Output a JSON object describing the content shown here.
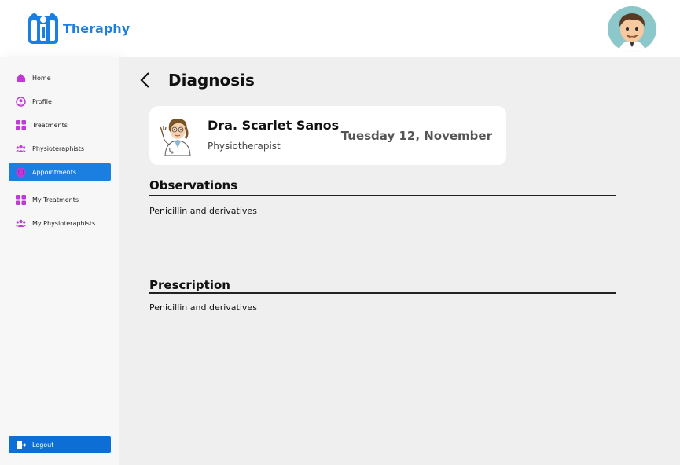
{
  "app": {
    "name": "Theraphy",
    "brand_color": "#1a7fe0"
  },
  "header": {
    "avatar_icon": "user-avatar-icon"
  },
  "sidebar": {
    "items": [
      {
        "label": "Home",
        "icon": "home-icon",
        "icon_color": "#c03ad8"
      },
      {
        "label": "Profile",
        "icon": "profile-icon",
        "icon_color": "#c03ad8"
      },
      {
        "label": "Treatments",
        "icon": "grid-icon",
        "icon_color": "#c03ad8"
      },
      {
        "label": "Physioteraphists",
        "icon": "people-icon",
        "icon_color": "#c03ad8"
      },
      {
        "label": "Appointments",
        "icon": "calendar-icon",
        "icon_color": "#c03ad8",
        "active": true
      },
      {
        "label": "My Treatments",
        "icon": "grid-icon",
        "icon_color": "#c03ad8"
      },
      {
        "label": "My Physioteraphists",
        "icon": "people-icon",
        "icon_color": "#c03ad8"
      }
    ],
    "logout_label": "Logout"
  },
  "main": {
    "title": "Diagnosis",
    "doctor": {
      "name": "Dra. Scarlet Sanos",
      "role": "Physiotherapist",
      "date": "Tuesday 12, November"
    },
    "observations": {
      "title": "Observations",
      "text": "Penicillin and derivatives"
    },
    "prescription": {
      "title": "Prescription",
      "text": "Penicillin and derivatives"
    }
  }
}
